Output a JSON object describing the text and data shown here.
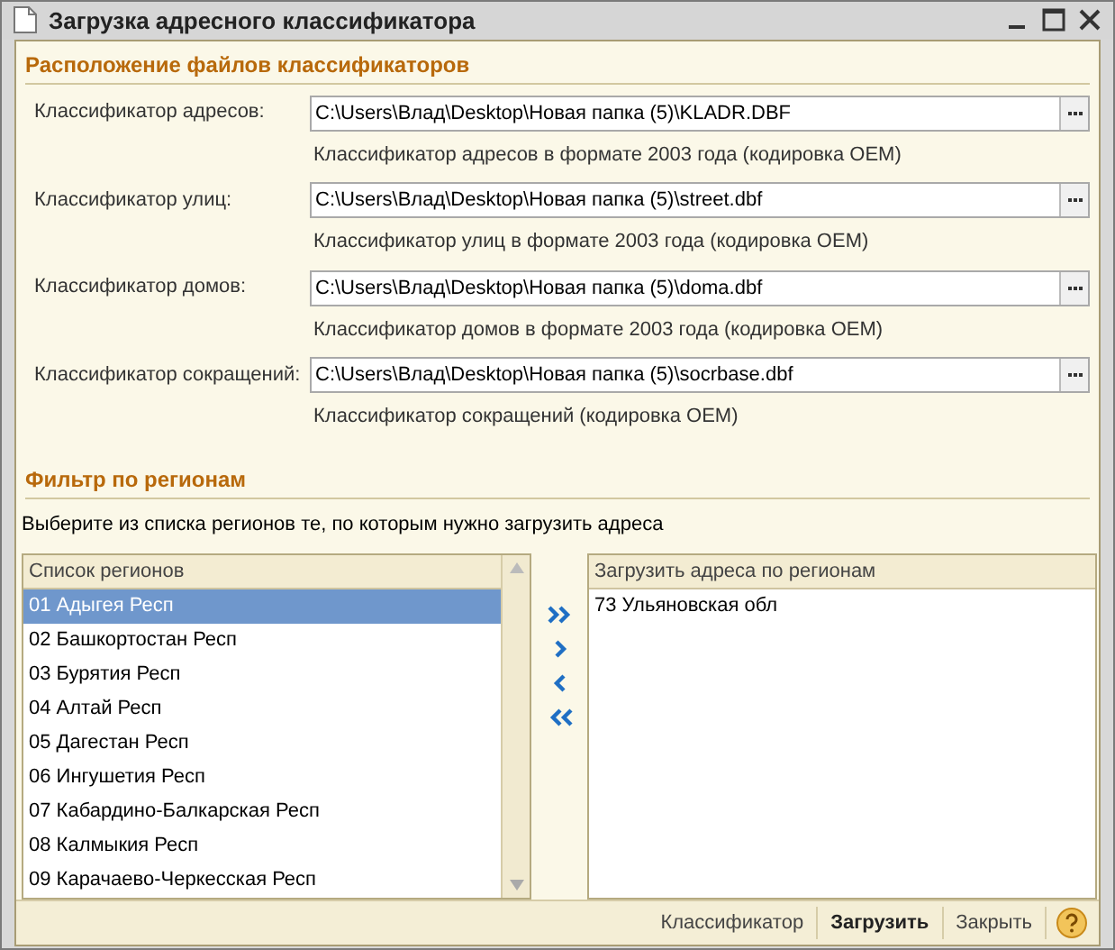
{
  "window": {
    "title": "Загрузка адресного классификатора"
  },
  "files_section": {
    "title": "Расположение файлов классификаторов",
    "rows": [
      {
        "label": "Классификатор адресов:",
        "value": "C:\\Users\\Влад\\Desktop\\Новая папка (5)\\KLADR.DBF",
        "note": "Классификатор адресов в формате  2003 года  (кодировка OEM)"
      },
      {
        "label": "Классификатор улиц:",
        "value": "C:\\Users\\Влад\\Desktop\\Новая папка (5)\\street.dbf",
        "note": "Классификатор улиц в формате  2003 года  (кодировка OEM)"
      },
      {
        "label": "Классификатор домов:",
        "value": "C:\\Users\\Влад\\Desktop\\Новая папка (5)\\doma.dbf",
        "note": "Классификатор домов в формате  2003 года  (кодировка OEM)"
      },
      {
        "label": "Классификатор сокращений:",
        "value": "C:\\Users\\Влад\\Desktop\\Новая папка (5)\\socrbase.dbf",
        "note": "Классификатор сокращений (кодировка OEM)"
      }
    ]
  },
  "filter_section": {
    "title": "Фильтр по регионам",
    "hint": "Выберите из списка регионов те, по которым нужно загрузить адреса",
    "available": {
      "header": "Список регионов",
      "items": [
        {
          "label": "01 Адыгея Респ",
          "selected": true
        },
        {
          "label": "02 Башкортостан Респ",
          "selected": false
        },
        {
          "label": "03 Бурятия Респ",
          "selected": false
        },
        {
          "label": "04 Алтай Респ",
          "selected": false
        },
        {
          "label": "05 Дагестан Респ",
          "selected": false
        },
        {
          "label": "06 Ингушетия Респ",
          "selected": false
        },
        {
          "label": "07 Кабардино-Балкарская Респ",
          "selected": false
        },
        {
          "label": "08 Калмыкия Респ",
          "selected": false
        },
        {
          "label": "09 Карачаево-Черкесская Респ",
          "selected": false
        }
      ]
    },
    "chosen": {
      "header": "Загрузить адреса по регионам",
      "items": [
        {
          "label": "73 Ульяновская обл",
          "selected": false
        }
      ]
    }
  },
  "footer": {
    "buttons": [
      {
        "label": "Классификатор",
        "default": false
      },
      {
        "label": "Загрузить",
        "default": true
      },
      {
        "label": "Закрыть",
        "default": false
      }
    ]
  }
}
